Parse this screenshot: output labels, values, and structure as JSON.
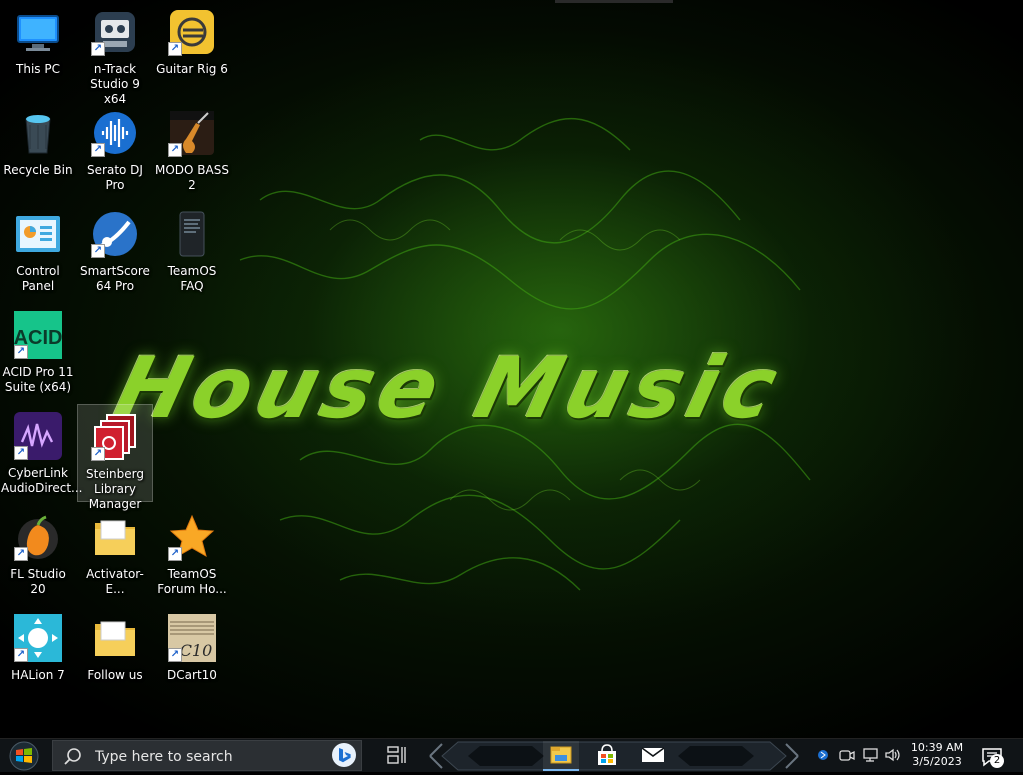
{
  "wallpaper": {
    "text": "House Music",
    "accent": "#8bd12a"
  },
  "desktop": {
    "icons": [
      {
        "label": "This PC",
        "icon": "monitor-icon",
        "shortcut": false
      },
      {
        "label": "n-Track\nStudio 9 x64",
        "icon": "cassette-icon",
        "shortcut": true
      },
      {
        "label": "Guitar Rig 6",
        "icon": "guitar-rig-icon",
        "shortcut": true
      },
      {
        "label": "Recycle Bin",
        "icon": "recycle-bin-icon",
        "shortcut": false
      },
      {
        "label": "Serato DJ Pro",
        "icon": "serato-icon",
        "shortcut": true
      },
      {
        "label": "MODO BASS\n2",
        "icon": "modo-bass-icon",
        "shortcut": true
      },
      {
        "label": "Control Panel",
        "icon": "control-panel-icon",
        "shortcut": false
      },
      {
        "label": "SmartScore\n64 Pro",
        "icon": "smartscore-icon",
        "shortcut": true
      },
      {
        "label": "TeamOS FAQ",
        "icon": "phone-doc-icon",
        "shortcut": false
      },
      {
        "label": "ACID Pro 11\nSuite (x64)",
        "icon": "acid-icon",
        "shortcut": true
      },
      {
        "label": "CyberLink\nAudioDirect...",
        "icon": "audiodirector-icon",
        "shortcut": true
      },
      {
        "label": "Steinberg\nLibrary\nManager",
        "icon": "steinberg-icon",
        "shortcut": true
      },
      {
        "label": "FL Studio 20",
        "icon": "fl-studio-icon",
        "shortcut": true
      },
      {
        "label": "Activator-E...",
        "icon": "folder-icon",
        "shortcut": false
      },
      {
        "label": "TeamOS\nForum Ho...",
        "icon": "star-icon",
        "shortcut": true
      },
      {
        "label": "HALion 7",
        "icon": "halion-icon",
        "shortcut": true
      },
      {
        "label": "Follow us",
        "icon": "folder-icon",
        "shortcut": false
      },
      {
        "label": "DCart10",
        "icon": "dcart-icon",
        "shortcut": true
      }
    ]
  },
  "taskbar": {
    "search_placeholder": "Type here to search",
    "apps": [
      "file-explorer-icon",
      "store-icon",
      "mail-icon"
    ],
    "clock": {
      "time": "10:39 AM",
      "date": "3/5/2023"
    },
    "notification_count": "2"
  },
  "colors": {
    "taskbar_bg": "#101417",
    "label_text": "#ffffff"
  }
}
